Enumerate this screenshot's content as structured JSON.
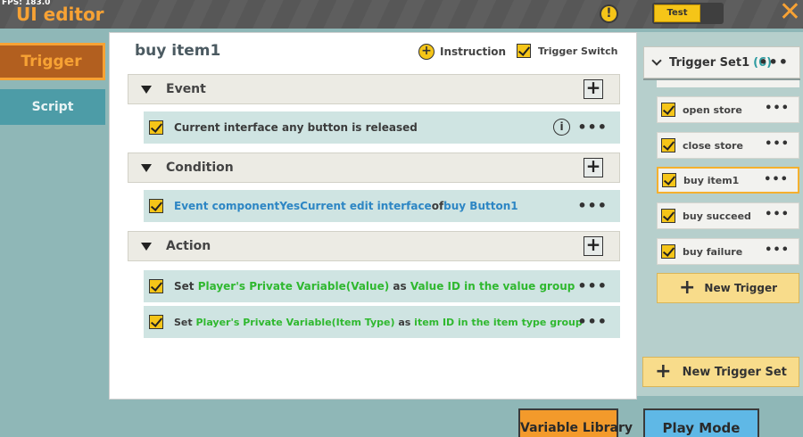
{
  "topbar": {
    "fps": "FPS: 183.0",
    "title": "UI editor",
    "warning_icon": "exclamation-icon",
    "test_label": "Test",
    "close_icon": "close-x-icon"
  },
  "nav": {
    "tabs": [
      {
        "label": "Trigger",
        "active": true
      },
      {
        "label": "Script",
        "active": false
      }
    ]
  },
  "main": {
    "title": "buy item1",
    "instruction_label": "Instruction",
    "trigger_switch_label": "Trigger Switch",
    "trigger_switch_checked": true,
    "sections": {
      "event": {
        "label": "Event",
        "rows": [
          {
            "checked": true,
            "parts": [
              "Current interface any button is released"
            ]
          }
        ]
      },
      "condition": {
        "label": "Condition",
        "rows": [
          {
            "checked": true,
            "parts": [
              "Event componentYesCurrent edit interface",
              "of",
              "buy Button1"
            ]
          }
        ]
      },
      "action": {
        "label": "Action",
        "rows": [
          {
            "checked": true,
            "parts": [
              "Set ",
              "Player's Private Variable(Value)",
              " as ",
              "Value ID in the value group"
            ]
          },
          {
            "checked": true,
            "parts": [
              "Set ",
              "Player's Private Variable(Item Type)",
              " as ",
              "item ID in the item type group"
            ]
          }
        ]
      }
    },
    "more_label": "•••",
    "info_label": "i"
  },
  "right": {
    "set_name": "Trigger Set1",
    "set_count": "(6)",
    "items": [
      {
        "label": "open store",
        "checked": true,
        "selected": false
      },
      {
        "label": "close store",
        "checked": true,
        "selected": false
      },
      {
        "label": "buy item1",
        "checked": true,
        "selected": true
      },
      {
        "label": "buy succeed",
        "checked": true,
        "selected": false
      },
      {
        "label": "buy failure",
        "checked": true,
        "selected": false
      }
    ],
    "new_trigger_label": "New Trigger",
    "new_trigger_set_label": "New Trigger Set"
  },
  "bottom": {
    "variable_library_label": "Variable Library",
    "play_mode_label": "Play Mode"
  },
  "colors": {
    "accent_orange": "#f7a234",
    "checkbox_yellow": "#f5c518",
    "text_blue": "#2d86c4",
    "text_green": "#2fb82f",
    "selected_border": "#f5b02e"
  }
}
